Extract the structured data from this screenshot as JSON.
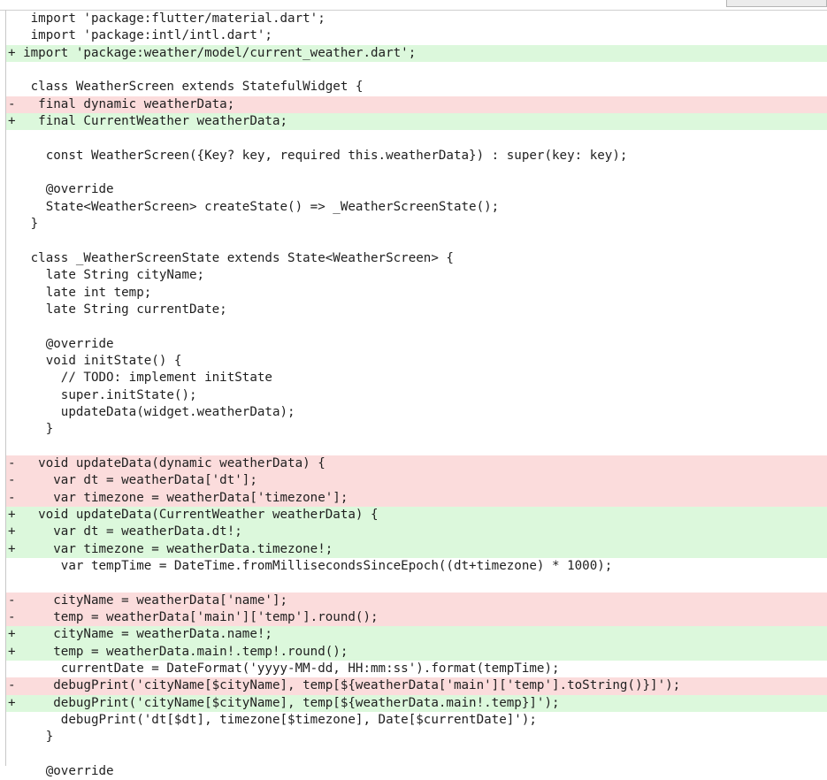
{
  "diff": {
    "lines": [
      {
        "marker": " ",
        "text": "  import 'package:flutter/material.dart';",
        "type": "ctx"
      },
      {
        "marker": " ",
        "text": "  import 'package:intl/intl.dart';",
        "type": "ctx"
      },
      {
        "marker": "+",
        "text": " import 'package:weather/model/current_weather.dart';",
        "type": "add"
      },
      {
        "marker": " ",
        "text": "",
        "type": "ctx"
      },
      {
        "marker": " ",
        "text": "  class WeatherScreen extends StatefulWidget {",
        "type": "ctx"
      },
      {
        "marker": "-",
        "text": "   final dynamic weatherData;",
        "type": "del"
      },
      {
        "marker": "+",
        "text": "   final CurrentWeather weatherData;",
        "type": "add"
      },
      {
        "marker": " ",
        "text": "",
        "type": "ctx"
      },
      {
        "marker": " ",
        "text": "    const WeatherScreen({Key? key, required this.weatherData}) : super(key: key);",
        "type": "ctx"
      },
      {
        "marker": " ",
        "text": "",
        "type": "ctx"
      },
      {
        "marker": " ",
        "text": "    @override",
        "type": "ctx"
      },
      {
        "marker": " ",
        "text": "    State<WeatherScreen> createState() => _WeatherScreenState();",
        "type": "ctx"
      },
      {
        "marker": " ",
        "text": "  }",
        "type": "ctx"
      },
      {
        "marker": " ",
        "text": "",
        "type": "ctx"
      },
      {
        "marker": " ",
        "text": "  class _WeatherScreenState extends State<WeatherScreen> {",
        "type": "ctx"
      },
      {
        "marker": " ",
        "text": "    late String cityName;",
        "type": "ctx"
      },
      {
        "marker": " ",
        "text": "    late int temp;",
        "type": "ctx"
      },
      {
        "marker": " ",
        "text": "    late String currentDate;",
        "type": "ctx"
      },
      {
        "marker": " ",
        "text": "",
        "type": "ctx"
      },
      {
        "marker": " ",
        "text": "    @override",
        "type": "ctx"
      },
      {
        "marker": " ",
        "text": "    void initState() {",
        "type": "ctx"
      },
      {
        "marker": " ",
        "text": "      // TODO: implement initState",
        "type": "ctx"
      },
      {
        "marker": " ",
        "text": "      super.initState();",
        "type": "ctx"
      },
      {
        "marker": " ",
        "text": "      updateData(widget.weatherData);",
        "type": "ctx"
      },
      {
        "marker": " ",
        "text": "    }",
        "type": "ctx"
      },
      {
        "marker": " ",
        "text": "",
        "type": "ctx"
      },
      {
        "marker": "-",
        "text": "   void updateData(dynamic weatherData) {",
        "type": "del"
      },
      {
        "marker": "-",
        "text": "     var dt = weatherData['dt'];",
        "type": "del"
      },
      {
        "marker": "-",
        "text": "     var timezone = weatherData['timezone'];",
        "type": "del"
      },
      {
        "marker": "+",
        "text": "   void updateData(CurrentWeather weatherData) {",
        "type": "add"
      },
      {
        "marker": "+",
        "text": "     var dt = weatherData.dt!;",
        "type": "add"
      },
      {
        "marker": "+",
        "text": "     var timezone = weatherData.timezone!;",
        "type": "add"
      },
      {
        "marker": " ",
        "text": "      var tempTime = DateTime.fromMillisecondsSinceEpoch((dt+timezone) * 1000);",
        "type": "ctx"
      },
      {
        "marker": " ",
        "text": "",
        "type": "ctx"
      },
      {
        "marker": "-",
        "text": "     cityName = weatherData['name'];",
        "type": "del"
      },
      {
        "marker": "-",
        "text": "     temp = weatherData['main']['temp'].round();",
        "type": "del"
      },
      {
        "marker": "+",
        "text": "     cityName = weatherData.name!;",
        "type": "add"
      },
      {
        "marker": "+",
        "text": "     temp = weatherData.main!.temp!.round();",
        "type": "add"
      },
      {
        "marker": " ",
        "text": "      currentDate = DateFormat('yyyy-MM-dd, HH:mm:ss').format(tempTime);",
        "type": "ctx"
      },
      {
        "marker": "-",
        "text": "     debugPrint('cityName[$cityName], temp[${weatherData['main']['temp'].toString()}]');",
        "type": "del"
      },
      {
        "marker": "+",
        "text": "     debugPrint('cityName[$cityName], temp[${weatherData.main!.temp}]');",
        "type": "add"
      },
      {
        "marker": " ",
        "text": "      debugPrint('dt[$dt], timezone[$timezone], Date[$currentDate]');",
        "type": "ctx"
      },
      {
        "marker": " ",
        "text": "    }",
        "type": "ctx"
      },
      {
        "marker": " ",
        "text": "",
        "type": "ctx"
      },
      {
        "marker": " ",
        "text": "    @override",
        "type": "ctx"
      }
    ]
  }
}
